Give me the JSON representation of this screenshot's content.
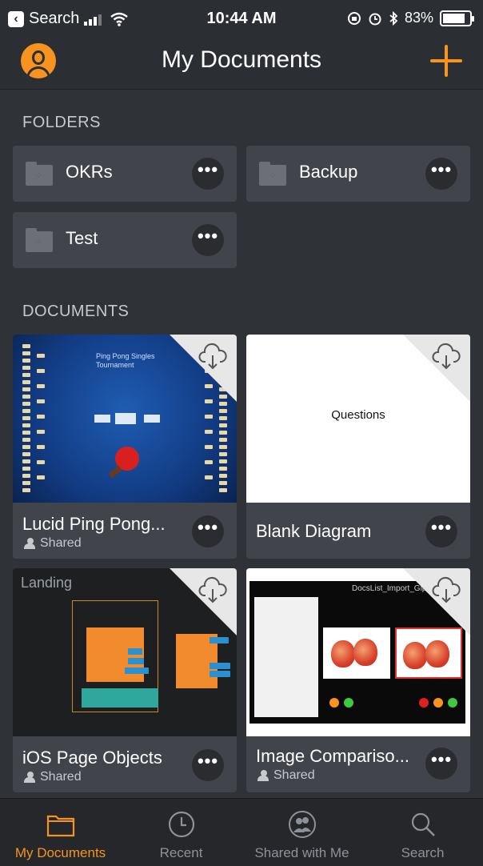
{
  "status_bar": {
    "back_app": "Search",
    "time": "10:44 AM",
    "battery_percent": "83%",
    "battery_level": 0.83
  },
  "nav": {
    "title": "My Documents"
  },
  "sections": {
    "folders": "FOLDERS",
    "documents": "DOCUMENTS"
  },
  "folders": [
    {
      "name": "OKRs"
    },
    {
      "name": "Backup"
    },
    {
      "name": "Test"
    }
  ],
  "documents": [
    {
      "name": "Lucid Ping Pong...",
      "shared_label": "Shared",
      "thumbnail_text": "Ping Pong Singles Tournament"
    },
    {
      "name": "Blank Diagram",
      "thumbnail_text": "Questions"
    },
    {
      "name": "iOS Page Objects",
      "shared_label": "Shared",
      "thumbnail_text": "Landing"
    },
    {
      "name": "Image Compariso...",
      "shared_label": "Shared",
      "thumbnail_text": "DocsList_Import_Giphy"
    }
  ],
  "more_glyph": "•••",
  "tabs": [
    {
      "label": "My Documents",
      "icon": "folder-icon",
      "active": true
    },
    {
      "label": "Recent",
      "icon": "clock-icon"
    },
    {
      "label": "Shared with Me",
      "icon": "shared-people-icon"
    },
    {
      "label": "Search",
      "icon": "search-icon"
    }
  ],
  "colors": {
    "accent": "#f7931e",
    "background": "#2f3237",
    "card": "#41454b",
    "tab_bar": "#25272b"
  }
}
